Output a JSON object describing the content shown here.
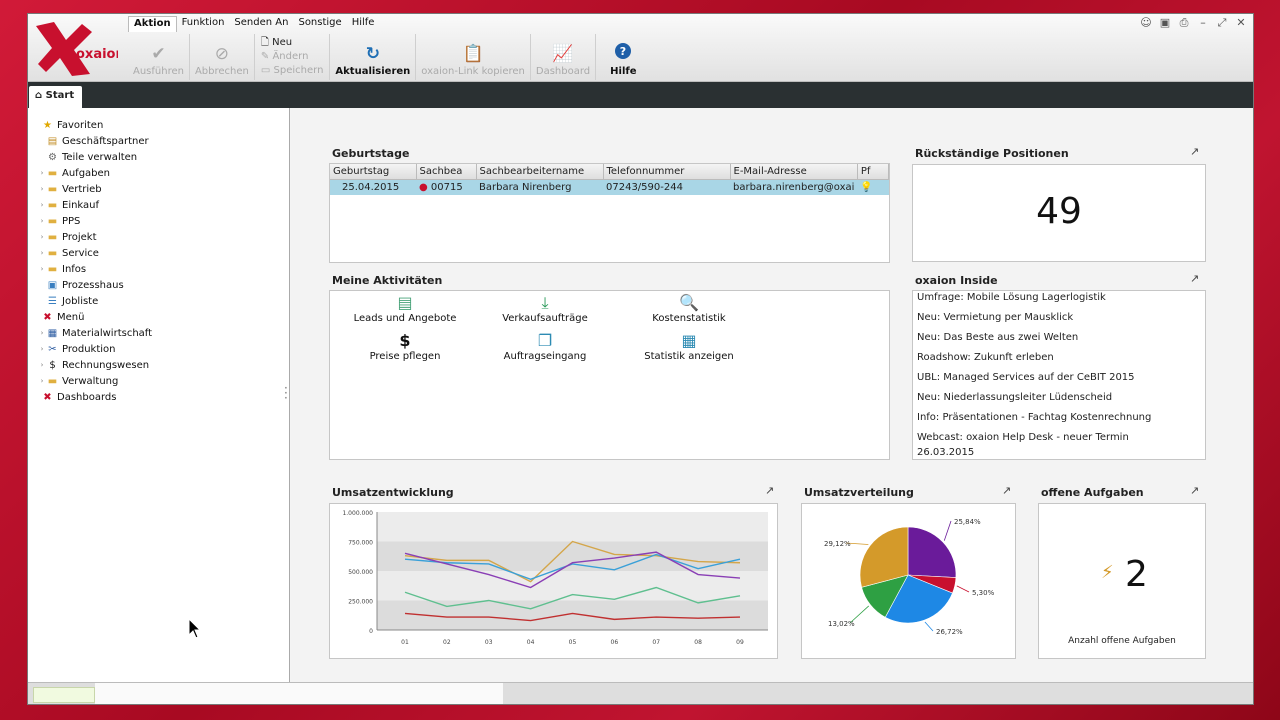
{
  "app": {
    "logo_text": "oxaion"
  },
  "menubar": [
    "Aktion",
    "Funktion",
    "Senden An",
    "Sonstige",
    "Hilfe"
  ],
  "toolbar": {
    "execute": "Ausführen",
    "cancel": "Abbrechen",
    "new": "Neu",
    "change": "Ändern",
    "save": "Speichern",
    "refresh": "Aktualisieren",
    "copy_link": "oxaion-Link kopieren",
    "dashboard": "Dashboard",
    "help": "Hilfe"
  },
  "tabs": {
    "start": "Start"
  },
  "sidebar": {
    "items": [
      {
        "label": "Favoriten",
        "icon": "star-icon",
        "level": 0
      },
      {
        "label": "Geschäftspartner",
        "icon": "contacts-icon",
        "level": 1
      },
      {
        "label": "Teile verwalten",
        "icon": "parts-icon",
        "level": 1
      },
      {
        "label": "Aufgaben",
        "icon": "folder-icon",
        "level": 1
      },
      {
        "label": "Vertrieb",
        "icon": "folder-icon",
        "level": 1
      },
      {
        "label": "Einkauf",
        "icon": "folder-icon",
        "level": 1
      },
      {
        "label": "PPS",
        "icon": "folder-icon",
        "level": 1
      },
      {
        "label": "Projekt",
        "icon": "folder-icon",
        "level": 1
      },
      {
        "label": "Service",
        "icon": "folder-icon",
        "level": 1
      },
      {
        "label": "Infos",
        "icon": "folder-icon",
        "level": 1
      },
      {
        "label": "Prozesshaus",
        "icon": "process-icon",
        "level": 1
      },
      {
        "label": "Jobliste",
        "icon": "list-icon",
        "level": 1
      },
      {
        "label": "Menü",
        "icon": "menu-logo-icon",
        "level": 0
      },
      {
        "label": "Materialwirtschaft",
        "icon": "material-icon",
        "level": 1
      },
      {
        "label": "Produktion",
        "icon": "production-icon",
        "level": 1
      },
      {
        "label": "Rechnungswesen",
        "icon": "dollar-icon",
        "level": 1
      },
      {
        "label": "Verwaltung",
        "icon": "folder-icon",
        "level": 1
      },
      {
        "label": "Dashboards",
        "icon": "menu-logo-icon",
        "level": 0
      }
    ]
  },
  "birthdays": {
    "title": "Geburtstage",
    "columns": [
      "Geburtstag",
      "Sachbea",
      "Sachbearbeitername",
      "Telefonnummer",
      "E-Mail-Adresse",
      "Pf"
    ],
    "rows": [
      {
        "date": "25.04.2015",
        "id": "00715",
        "name": "Barbara Nirenberg",
        "phone": "07243/590-244",
        "email": "barbara.nirenberg@oxai"
      }
    ]
  },
  "overdue": {
    "title": "Rückständige Positionen",
    "value": "49"
  },
  "activities": {
    "title": "Meine Aktivitäten",
    "items": [
      {
        "label": "Leads und Angebote",
        "icon": "leads-icon"
      },
      {
        "label": "Verkaufsaufträge",
        "icon": "download-icon"
      },
      {
        "label": "Kostenstatistik",
        "icon": "magnifier-doc-icon"
      },
      {
        "label": "Preise pflegen",
        "icon": "dollar-icon",
        "glyph": "$"
      },
      {
        "label": "Auftragseingang",
        "icon": "stack-icon"
      },
      {
        "label": "Statistik anzeigen",
        "icon": "chart-window-icon"
      }
    ]
  },
  "inside": {
    "title": "oxaion Inside",
    "items": [
      "Umfrage: Mobile Lösung Lagerlogistik",
      "Neu: Vermietung per Mausklick",
      "Neu: Das Beste aus zwei Welten",
      "Roadshow: Zukunft erleben",
      "UBL: Managed Services auf der CeBIT 2015",
      "Neu: Niederlassungsleiter Lüdenscheid",
      "Info: Präsentationen - Fachtag Kostenrechnung",
      "Webcast: oxaion Help Desk - neuer Termin",
      "26.03.2015"
    ]
  },
  "umsatz_title": "Umsatzentwicklung",
  "verteilung_title": "Umsatzverteilung",
  "tasks": {
    "title": "offene Aufgaben",
    "value": "2",
    "caption": "Anzahl offene Aufgaben"
  },
  "expand_glyph": "↗",
  "chart_data": [
    {
      "type": "line",
      "title": "Umsatzentwicklung",
      "categories": [
        "01",
        "02",
        "03",
        "04",
        "05",
        "06",
        "07",
        "08",
        "09"
      ],
      "ylim": [
        0,
        1000000
      ],
      "yticks": [
        "0",
        "250.000",
        "500.000",
        "750.000",
        "1.000.000"
      ],
      "grid": true,
      "series": [
        {
          "color": "#d4a64a",
          "values": [
            630000,
            590000,
            590000,
            410000,
            750000,
            640000,
            630000,
            580000,
            570000
          ]
        },
        {
          "color": "#3aa0d8",
          "values": [
            600000,
            570000,
            560000,
            430000,
            560000,
            510000,
            640000,
            520000,
            600000
          ]
        },
        {
          "color": "#8a3fb5",
          "values": [
            650000,
            560000,
            470000,
            360000,
            570000,
            610000,
            660000,
            470000,
            440000
          ]
        },
        {
          "color": "#5fbf8f",
          "values": [
            320000,
            200000,
            250000,
            180000,
            300000,
            260000,
            360000,
            230000,
            290000
          ]
        },
        {
          "color": "#c03030",
          "values": [
            140000,
            110000,
            110000,
            80000,
            140000,
            90000,
            110000,
            100000,
            110000
          ]
        }
      ]
    },
    {
      "type": "pie",
      "title": "Umsatzverteilung",
      "slices": [
        {
          "label": "25,84%",
          "value": 25.84,
          "color": "#6a1b9a"
        },
        {
          "label": "5,30%",
          "value": 5.3,
          "color": "#c8102e"
        },
        {
          "label": "26,72%",
          "value": 26.72,
          "color": "#1e88e5"
        },
        {
          "label": "13,02%",
          "value": 13.02,
          "color": "#2ea043"
        },
        {
          "label": "29,12%",
          "value": 29.12,
          "color": "#d49a2a"
        }
      ]
    }
  ],
  "colors": {
    "accent": "#c8102e",
    "tabbar": "#2a3032",
    "selected_row": "#a9d6e6"
  }
}
